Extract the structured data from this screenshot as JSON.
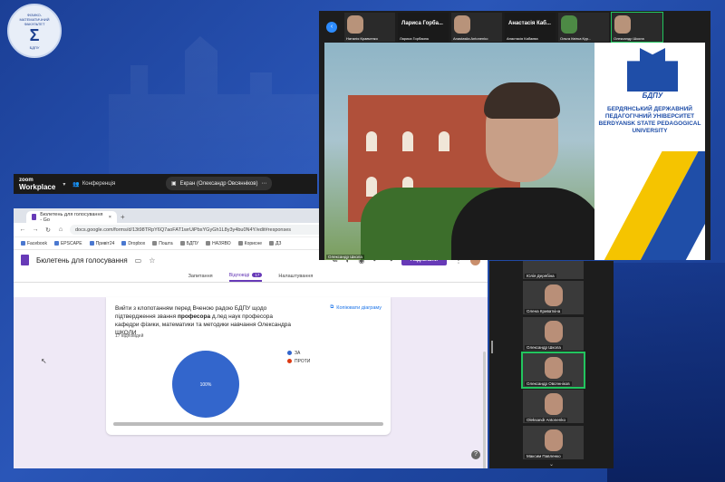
{
  "logo": {
    "top_text": "ФІЗИКО-МАТЕМАТИЧНИЙ ФАКУЛЬТЕТ",
    "glyph": "Σ",
    "bottom_text": "БДПУ"
  },
  "zoom": {
    "brand_small": "zoom",
    "brand_big": "Workplace",
    "menu_label": "Конференція",
    "share_label": "Екран (Олександр Овсянніков)"
  },
  "browser": {
    "tab_title": "Бюлетень для голосування - Go",
    "tab_add": "+",
    "url": "docs.google.com/forms/d/13t98TRpY6Q7aoFAT1wrUiPbsYGyGh1L8y3y4bu0N4Y/edit#responses",
    "bookmarks": [
      "Facebook",
      "EPSCAPE",
      "Привіт24",
      "Dropbox",
      "Пошта",
      "БДПУ",
      "НАЗЯВО",
      "Корисне",
      "ДЗ"
    ]
  },
  "forms": {
    "title": "Бюлетень для голосування",
    "send_label": "Надіслати",
    "tabs": {
      "questions": "Запитання",
      "responses": "Відповіді",
      "responses_count": "17",
      "settings": "Налаштування"
    }
  },
  "card": {
    "question_pre": "Вийти з клопотанням перед Вченою радою БДПУ щодо підтвердження звання ",
    "question_bold": "професора",
    "question_post": " д.пед наук професора кафедри фізики, математики та методики навчання Олександра ШКОЛИ",
    "count": "17 відповідей",
    "copy_label": "Копіювати діаграму",
    "help": "?"
  },
  "chart_data": {
    "type": "pie",
    "categories": [
      "ЗА",
      "ПРОТИ"
    ],
    "values": [
      100,
      0
    ],
    "slice_label": "100%",
    "colors": [
      "#3366cc",
      "#dc3912"
    ]
  },
  "thumbnails": [
    {
      "name": "",
      "label": "Наталія Кравченко"
    },
    {
      "name": "Лариса Горба...",
      "label": "Лариса Горбасюк"
    },
    {
      "name": "",
      "label": "Anastasiia Antonenko"
    },
    {
      "name": "Анастасія Каб...",
      "label": "Анастасія Кабаєва"
    },
    {
      "name": "",
      "label": "Ольга Квітка Кур..."
    },
    {
      "name": "",
      "label": "Олександр Школа"
    }
  ],
  "main_video": {
    "crest_label": "БДПУ",
    "university": "БЕРДЯНСЬКИЙ ДЕРЖАВНИЙ ПЕДАГОГІЧНИЙ УНІВЕРСИТЕТ BERDYANSK STATE PEDAGOGICAL UNIVERSITY",
    "speaker": "Олександр Школа"
  },
  "gallery": [
    {
      "name": "Юлія Дерябіна"
    },
    {
      "name": "Олена Криваткіна"
    },
    {
      "name": "Олександр Школа"
    },
    {
      "name": "Олександр Овсянніков"
    },
    {
      "name": "Oleksandr Antonenko"
    },
    {
      "name": "Максим Павленко"
    }
  ]
}
